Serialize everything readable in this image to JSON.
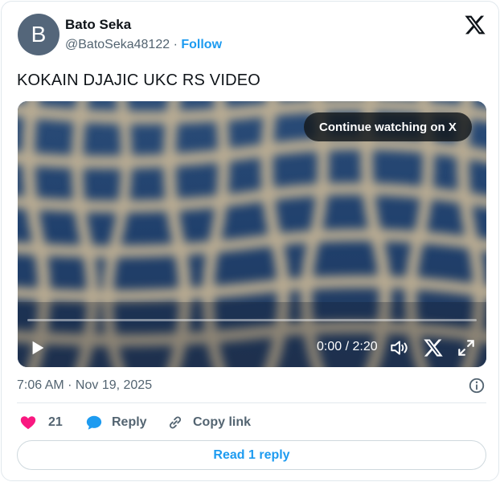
{
  "author": {
    "avatar_letter": "B",
    "name": "Bato Seka",
    "handle": "@BatoSeka48122",
    "separator": "·",
    "follow_label": "Follow"
  },
  "brand": {
    "icon": "x-logo-icon"
  },
  "tweet": {
    "text": "KOKAIN DJAJIC UKC RS VIDEO"
  },
  "video": {
    "continue_label": "Continue watching on X",
    "time": "0:00 / 2:20",
    "progress": 0,
    "controls": [
      "play-icon",
      "volume-icon",
      "x-logo-icon",
      "fullscreen-icon"
    ]
  },
  "meta": {
    "timestamp": "7:06 AM · Nov 19, 2025",
    "info_icon": "info-icon"
  },
  "actions": {
    "like_count": "21",
    "reply_label": "Reply",
    "copy_link_label": "Copy link"
  },
  "read_replies_label": "Read 1 reply",
  "colors": {
    "accent": "#1d9bf0",
    "like": "#f91880",
    "text_secondary": "#536471",
    "video_bg": "#1f3e68"
  }
}
